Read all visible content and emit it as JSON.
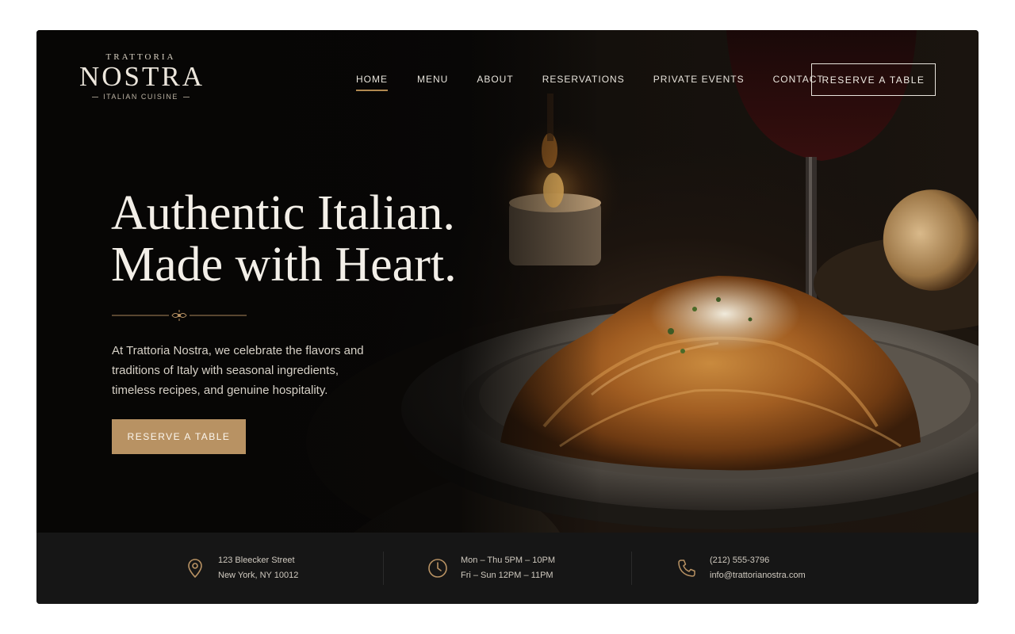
{
  "brand": {
    "top": "TRATTORIA",
    "name": "NOSTRA",
    "tagline": "ITALIAN CUISINE"
  },
  "nav": {
    "items": [
      {
        "label": "HOME",
        "active": true
      },
      {
        "label": "MENU"
      },
      {
        "label": "ABOUT"
      },
      {
        "label": "RESERVATIONS"
      },
      {
        "label": "PRIVATE EVENTS"
      },
      {
        "label": "CONTACT"
      }
    ],
    "cta_label": "RESERVE A TABLE"
  },
  "hero": {
    "headline_line1": "Authentic Italian.",
    "headline_line2": "Made with Heart.",
    "intro": "At Trattoria Nostra, we celebrate the flavors and traditions of Italy with seasonal ingredients, timeless recipes, and genuine hospitality.",
    "cta_label": "RESERVE A TABLE"
  },
  "info": {
    "address_line1": "123 Bleecker Street",
    "address_line2": "New York, NY 10012",
    "hours_line1": "Mon – Thu 5PM – 10PM",
    "hours_line2": "Fri – Sun 12PM – 11PM",
    "phone": "(212) 555-3796",
    "email": "info@trattorianostra.com"
  },
  "colors": {
    "accent": "#b89263",
    "background": "#0b0a09",
    "infobar": "#161616"
  },
  "icons": {
    "address": "map-pin-icon",
    "hours": "clock-icon",
    "contact": "phone-icon"
  }
}
